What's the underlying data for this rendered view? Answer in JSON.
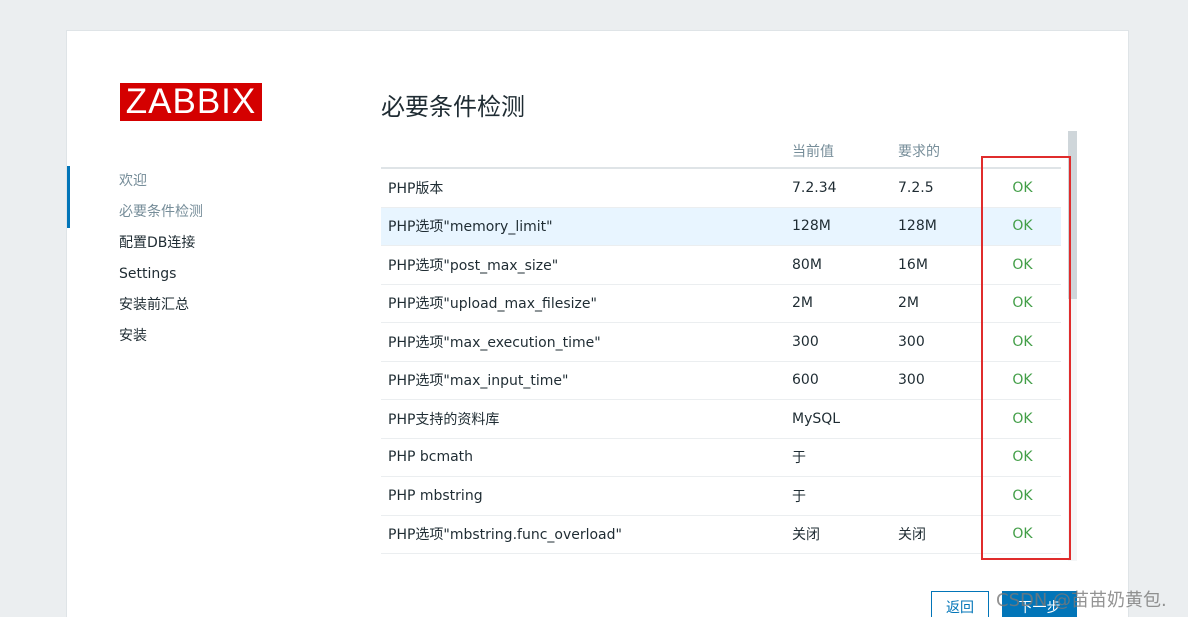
{
  "logo": "ZABBIX",
  "nav": {
    "items": [
      {
        "label": "欢迎",
        "state": "done"
      },
      {
        "label": "必要条件检测",
        "state": "current"
      },
      {
        "label": "配置DB连接",
        "state": "todo"
      },
      {
        "label": "Settings",
        "state": "todo"
      },
      {
        "label": "安装前汇总",
        "state": "todo"
      },
      {
        "label": "安装",
        "state": "todo"
      }
    ]
  },
  "page_title": "必要条件检测",
  "table": {
    "headers": [
      "",
      "当前值",
      "要求的",
      ""
    ],
    "rows": [
      {
        "name": "PHP版本",
        "current": "7.2.34",
        "required": "7.2.5",
        "status": "OK"
      },
      {
        "name": "PHP选项\"memory_limit\"",
        "current": "128M",
        "required": "128M",
        "status": "OK"
      },
      {
        "name": "PHP选项\"post_max_size\"",
        "current": "80M",
        "required": "16M",
        "status": "OK"
      },
      {
        "name": "PHP选项\"upload_max_filesize\"",
        "current": "2M",
        "required": "2M",
        "status": "OK"
      },
      {
        "name": "PHP选项\"max_execution_time\"",
        "current": "300",
        "required": "300",
        "status": "OK"
      },
      {
        "name": "PHP选项\"max_input_time\"",
        "current": "600",
        "required": "300",
        "status": "OK"
      },
      {
        "name": "PHP支持的资料库",
        "current": "MySQL",
        "required": "",
        "status": "OK"
      },
      {
        "name": "PHP bcmath",
        "current": "于",
        "required": "",
        "status": "OK"
      },
      {
        "name": "PHP mbstring",
        "current": "于",
        "required": "",
        "status": "OK"
      },
      {
        "name": "PHP选项\"mbstring.func_overload\"",
        "current": "关闭",
        "required": "关闭",
        "status": "OK"
      }
    ]
  },
  "buttons": {
    "back": "返回",
    "next": "下一步"
  },
  "watermark": "CSDN @苗苗奶黄包.",
  "colors": {
    "ok": "#429e47",
    "accent": "#0275b8",
    "logo_bg": "#d40000",
    "annotation": "#e02c2c"
  }
}
